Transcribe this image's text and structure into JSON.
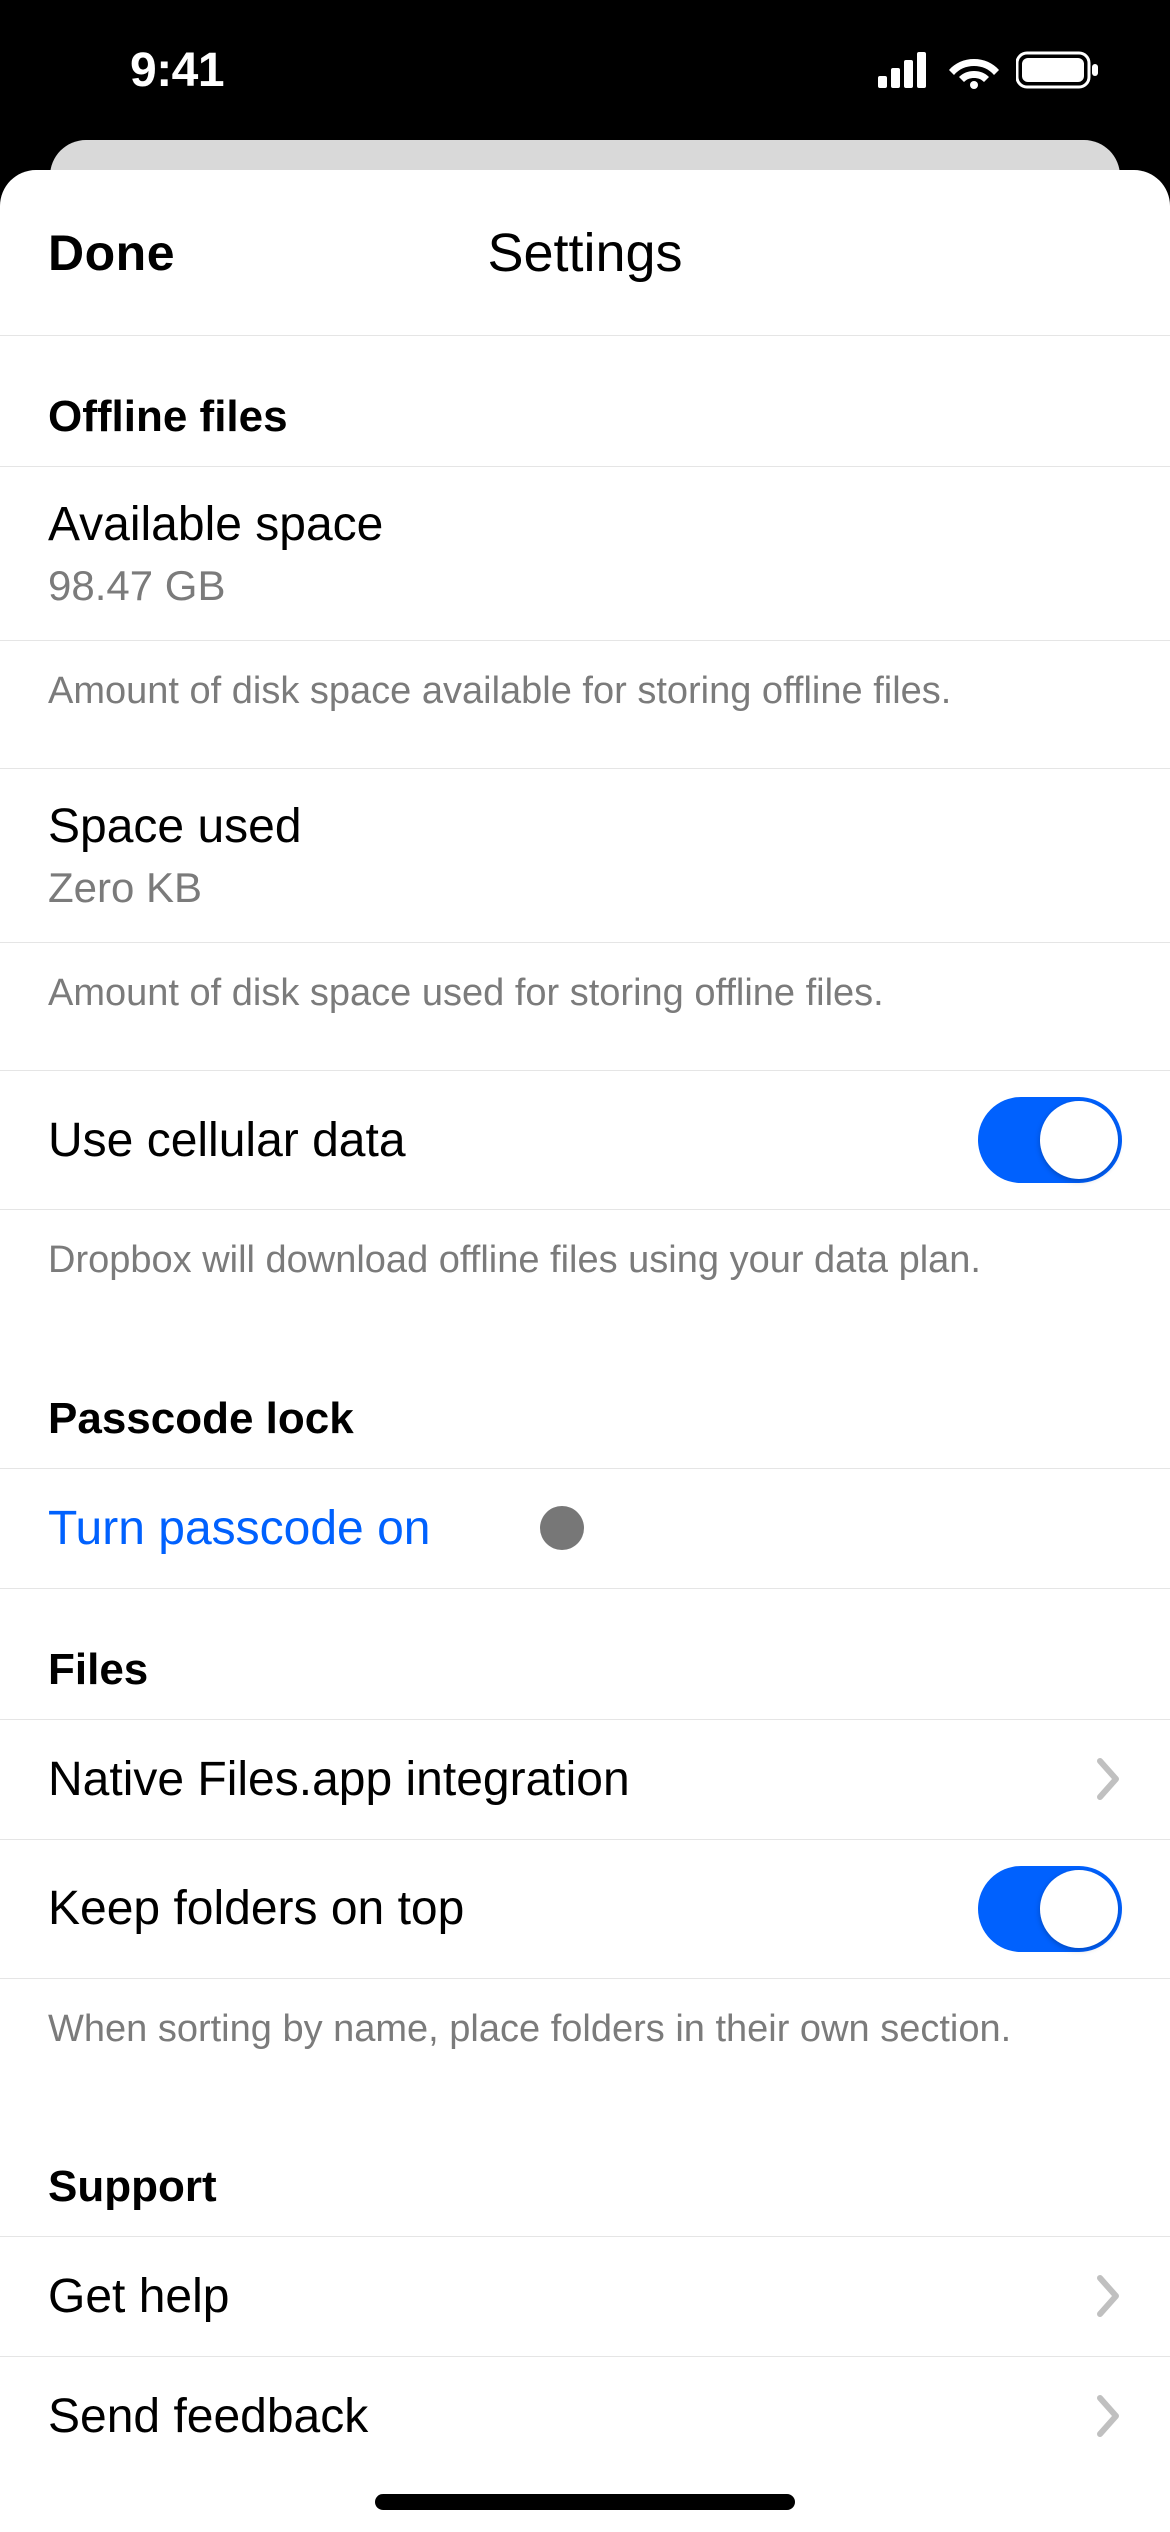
{
  "status": {
    "time": "9:41"
  },
  "nav": {
    "done": "Done",
    "title": "Settings"
  },
  "offline": {
    "header": "Offline files",
    "availableLabel": "Available space",
    "availableValue": "98.47 GB",
    "availableFooter": "Amount of disk space available for storing offline files.",
    "usedLabel": "Space used",
    "usedValue": "Zero KB",
    "usedFooter": "Amount of disk space used for storing offline files.",
    "cellularLabel": "Use cellular data",
    "cellularOn": true,
    "cellularFooter": "Dropbox will download offline files using your data plan."
  },
  "passcode": {
    "header": "Passcode lock",
    "turnOn": "Turn passcode on"
  },
  "files": {
    "header": "Files",
    "native": "Native Files.app integration",
    "keepFolders": "Keep folders on top",
    "keepFoldersOn": true,
    "keepFoldersFooter": "When sorting by name, place folders in their own section."
  },
  "support": {
    "header": "Support",
    "getHelp": "Get help",
    "sendFeedback": "Send feedback"
  }
}
